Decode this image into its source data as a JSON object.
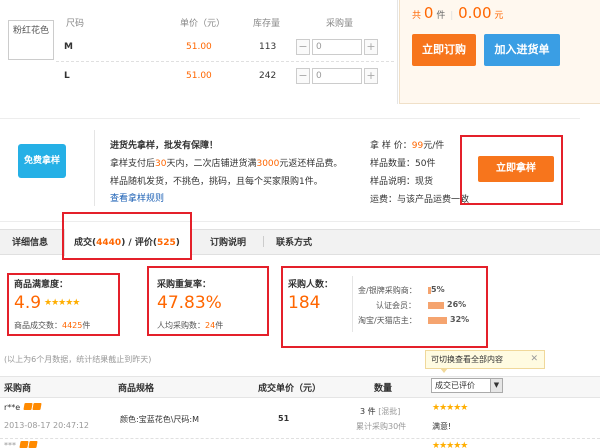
{
  "sku": {
    "color_name": "粉红花色",
    "headers": {
      "size": "尺码",
      "price": "单价（元）",
      "stock": "库存量",
      "qty": "采购量"
    },
    "rows": [
      {
        "size": "M",
        "price": "51.00",
        "stock": "113",
        "qty": "0"
      },
      {
        "size": "L",
        "price": "51.00",
        "stock": "242",
        "qty": "0"
      }
    ],
    "minus": "−",
    "plus": "+"
  },
  "summary": {
    "prefix": "共",
    "count": "0",
    "unit": "件",
    "amount": "0.00",
    "currency": "元"
  },
  "actions": {
    "order": "立即订购",
    "add_cart": "加入进货单"
  },
  "sample": {
    "badge": "免费拿样",
    "title": "进货先拿样，批发有保障！",
    "line2_a": "拿样支付后",
    "line2_days": "30",
    "line2_b": "天内，二次店铺进货满",
    "line2_amount": "3000",
    "line2_c": "元返还样品费。",
    "line3": "样品随机发货，不挑色，挑码，且每个买家限购1件。",
    "rules_link": "查看拿样规则",
    "price_label": "拿 样 价：",
    "price_value": "99",
    "price_unit": "元/件",
    "qty_label": "样品数量：",
    "qty_value": "50",
    "qty_unit": "件",
    "desc_label": "样品说明：",
    "desc_value": "现货",
    "ship_label": "运费：",
    "ship_value": "与该产品运费一致",
    "button": "立即拿样"
  },
  "tabs": {
    "detail": "详细信息",
    "deals_prefix": "成交(",
    "deals_count": "4440",
    "deals_mid": ") / 评价(",
    "reviews_count": "525",
    "deals_suffix": ")",
    "order_info": "订购说明",
    "contact": "联系方式"
  },
  "stats": {
    "satisfaction_label": "商品满意度：",
    "satisfaction_value": "4.9",
    "satisfaction_stars": 4.9,
    "deals_label": "商品成交数：",
    "deals_value": "4425",
    "deals_unit": "件",
    "repurchase_label": "采购重复率：",
    "repurchase_value": "47.83%",
    "avg_label": "人均采购数：",
    "avg_value": "24",
    "avg_unit": "件",
    "buyers_label": "采购人数：",
    "buyers_value": "184",
    "breakdown": [
      {
        "label": "金/银牌采购商：",
        "pct": "5%",
        "fraction": 0.05
      },
      {
        "label": "认证会员：",
        "pct": "26%",
        "fraction": 0.26
      },
      {
        "label": "淘宝/天猫店主：",
        "pct": "32%",
        "fraction": 0.32
      }
    ]
  },
  "note": "(以上为6个月数据，统计结果截止到昨天)",
  "tooltip": {
    "text": "可切换查看全部内容",
    "close": "✕"
  },
  "table": {
    "headers": {
      "buyer": "采购商",
      "spec": "商品规格",
      "price": "成交单价（元）",
      "qty": "数量"
    },
    "filter": "成交已评价",
    "rows": [
      {
        "buyer": "r**e",
        "time": "2013-08-17 20:47:12",
        "spec": "颜色:宝蓝花色\\尺码:M",
        "price": "51",
        "qty": "3 件",
        "mixed": "[混批]",
        "total": "累计采购30件",
        "review": "满意!"
      }
    ]
  },
  "colors": {
    "accent": "#ff6600",
    "order_btn": "#f7751c",
    "cart_btn": "#3a9ee4",
    "highlight": "#e4202a"
  }
}
